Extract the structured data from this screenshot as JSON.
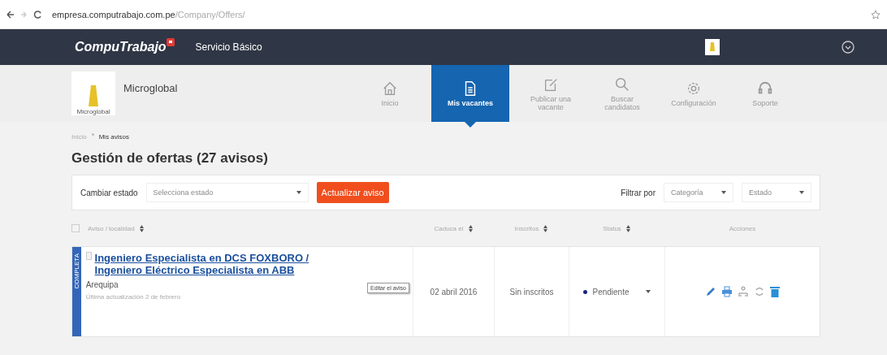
{
  "browser": {
    "url_host": "empresa.computrabajo.com.pe",
    "url_path": "/Company/Offers/"
  },
  "header": {
    "brand": "CompuTrabajo",
    "plan": "Servicio Básico"
  },
  "company": {
    "name": "Microglobal",
    "logo_caption": "Microglobal"
  },
  "nav": [
    {
      "label": "Inicio",
      "selected": false
    },
    {
      "label": "Mis vacantes",
      "selected": true
    },
    {
      "label": "Publicar una vacante",
      "selected": false
    },
    {
      "label": "Buscar candidatos",
      "selected": false
    },
    {
      "label": "Configuración",
      "selected": false
    },
    {
      "label": "Soporte",
      "selected": false
    }
  ],
  "breadcrumb": [
    "Inicio",
    "Mis avisos"
  ],
  "title": "Gestión de ofertas (27 avisos)",
  "toolbar": {
    "change_label": "Cambiar estado",
    "status_select": {
      "placeholder": "Selecciona estado"
    },
    "update_button": "Actualizar aviso",
    "filter_label": "Filtrar por",
    "filters": [
      "Categoría",
      "Estado"
    ]
  },
  "table": {
    "select_all_checked": false,
    "columns": [
      {
        "label": "Aviso / localidad",
        "sortable": true
      },
      {
        "label": "Caduca el",
        "sortable": true
      },
      {
        "label": "Inscritos",
        "sortable": true
      },
      {
        "label": "Status",
        "sortable": true
      },
      {
        "label": "Acciones",
        "sortable": false
      }
    ],
    "rows": [
      {
        "band": "COMPLETA",
        "checked": false,
        "title": "Ingeniero Especialista en DCS FOXBORO / Ingeniero Eléctrico Especialista en ABB",
        "location": "Arequipa",
        "updated": "Última actualización 2 de febrero",
        "tooltip": "Editar el aviso",
        "expires": "02 abril 2016",
        "applicants": "Sin inscritos",
        "status": "Pendiente"
      }
    ]
  }
}
